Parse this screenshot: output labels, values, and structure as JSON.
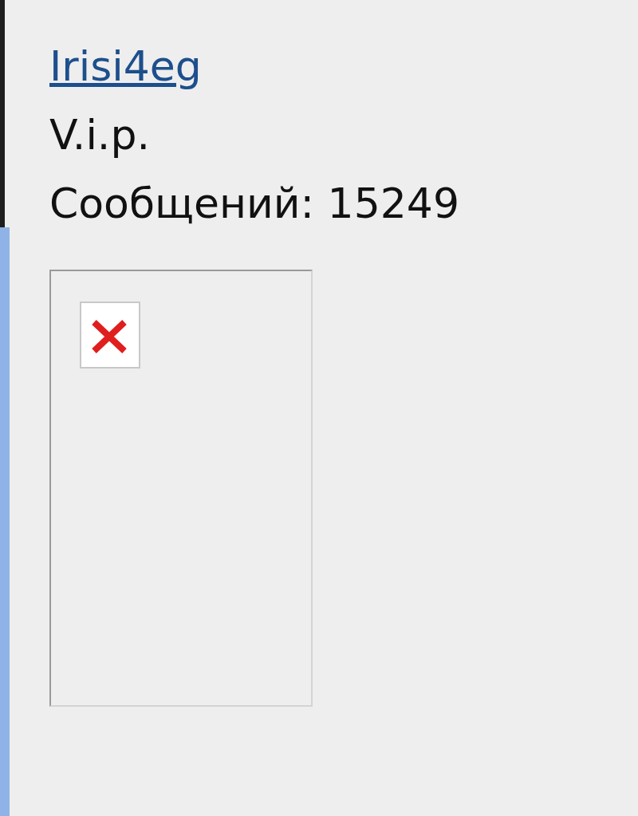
{
  "user": {
    "name": "Irisi4eg",
    "rank": "V.i.p.",
    "posts": "Сообщений: 15249"
  },
  "avatar": {
    "kind": "broken-image"
  }
}
